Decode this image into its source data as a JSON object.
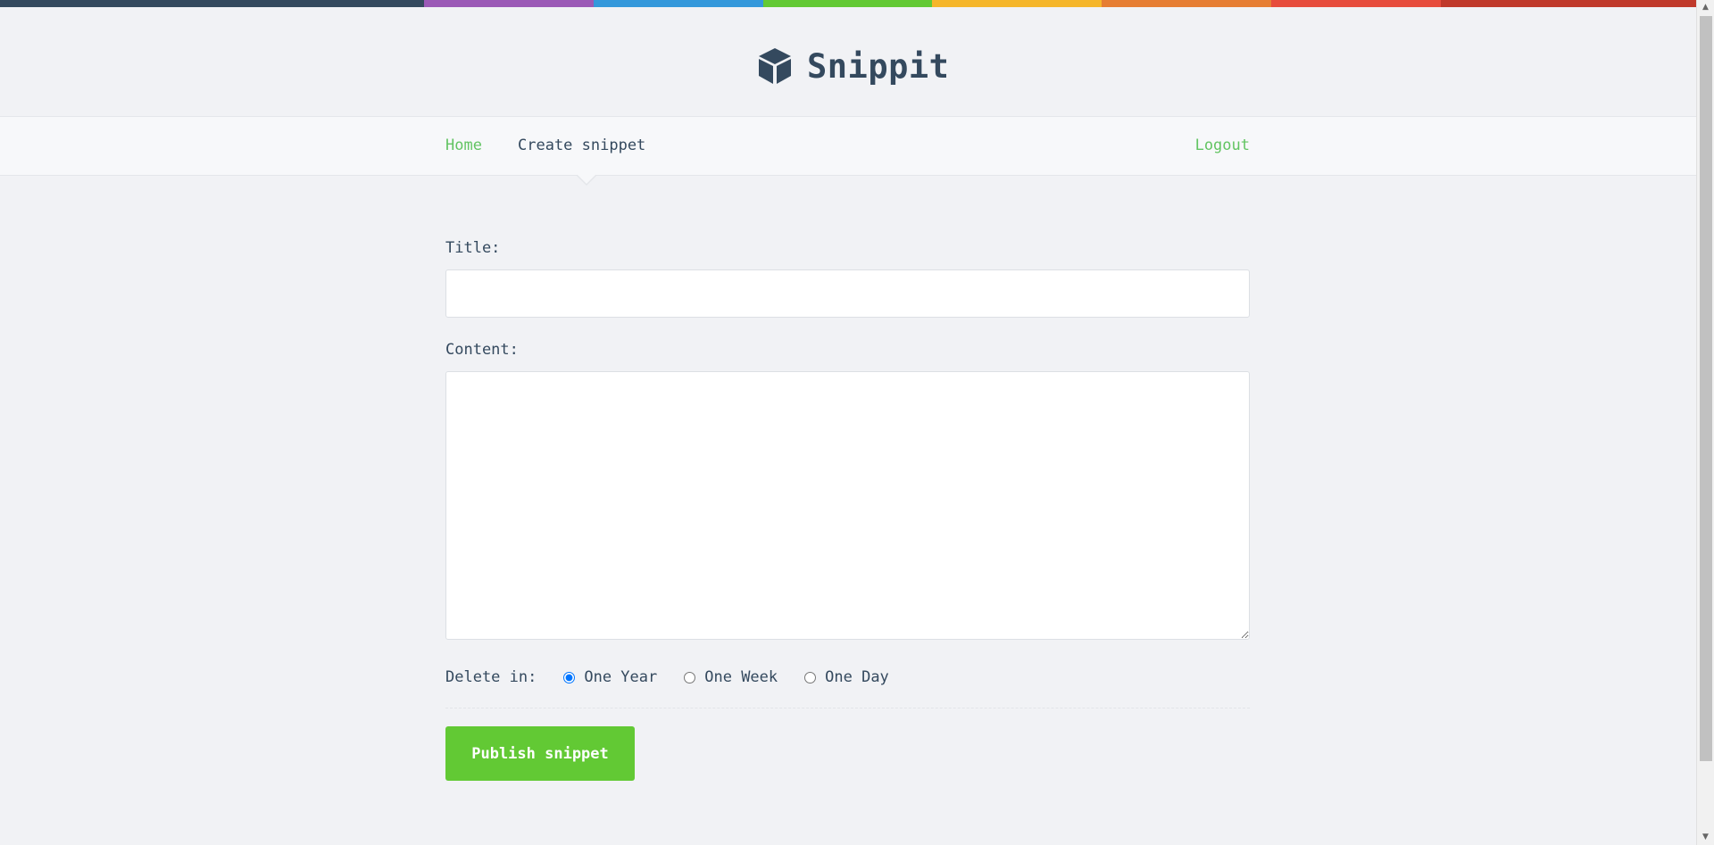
{
  "colors": {
    "stripe": [
      "#34495e",
      "#9b59b6",
      "#3498db",
      "#62c934",
      "#f5b62a",
      "#e67e33",
      "#e74c3c",
      "#c0392b"
    ],
    "accent": "#62c462",
    "button": "#62c934",
    "text": "#34495e"
  },
  "brand": {
    "name": "Snippit",
    "icon": "cube-icon"
  },
  "nav": {
    "home": "Home",
    "create": "Create snippet",
    "logout": "Logout"
  },
  "form": {
    "title_label": "Title:",
    "title_value": "",
    "content_label": "Content:",
    "content_value": "",
    "delete_label": "Delete in:",
    "delete_options": [
      {
        "label": "One Year",
        "checked": true
      },
      {
        "label": "One Week",
        "checked": false
      },
      {
        "label": "One Day",
        "checked": false
      }
    ],
    "submit_label": "Publish snippet"
  }
}
